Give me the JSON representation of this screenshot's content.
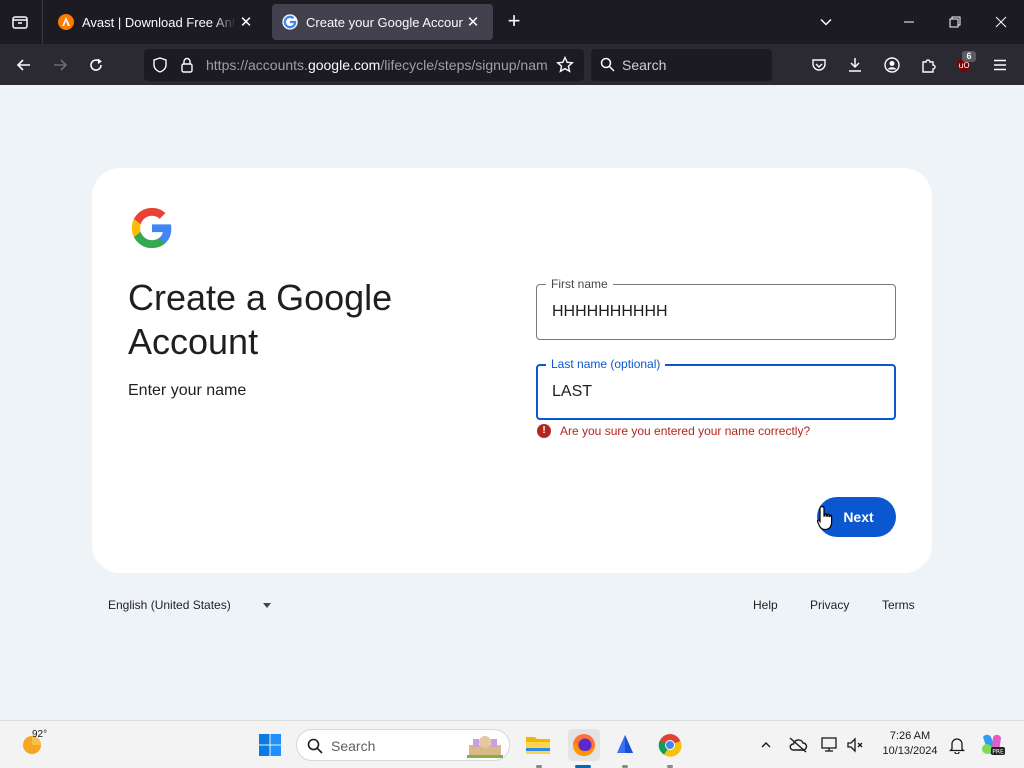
{
  "browser": {
    "tabs": [
      {
        "title": "Avast | Download Free Antivirus",
        "active": false
      },
      {
        "title": "Create your Google Account",
        "active": true
      }
    ],
    "url_prefix": "https://accounts.",
    "url_domain": "google.com",
    "url_path": "/lifecycle/steps/signup/name?continue=https",
    "search_placeholder": "Search",
    "extension_badge": "6"
  },
  "page": {
    "heading": "Create a Google Account",
    "subheading": "Enter your name",
    "first_name": {
      "label": "First name",
      "value": "HHHHHHHHHH"
    },
    "last_name": {
      "label": "Last name (optional)",
      "value": "LAST"
    },
    "error": "Are you sure you entered your name correctly?",
    "next_label": "Next"
  },
  "footer": {
    "language": "English (United States)",
    "links": [
      "Help",
      "Privacy",
      "Terms"
    ]
  },
  "taskbar": {
    "temperature": "92°",
    "search_placeholder": "Search",
    "time": "7:26 AM",
    "date": "10/13/2024"
  },
  "colors": {
    "accent": "#0b57d0",
    "error": "#b3261e",
    "page_bg": "#eef3f8",
    "tab_bar": "#1c1b22",
    "toolbar": "#2b2a33"
  }
}
